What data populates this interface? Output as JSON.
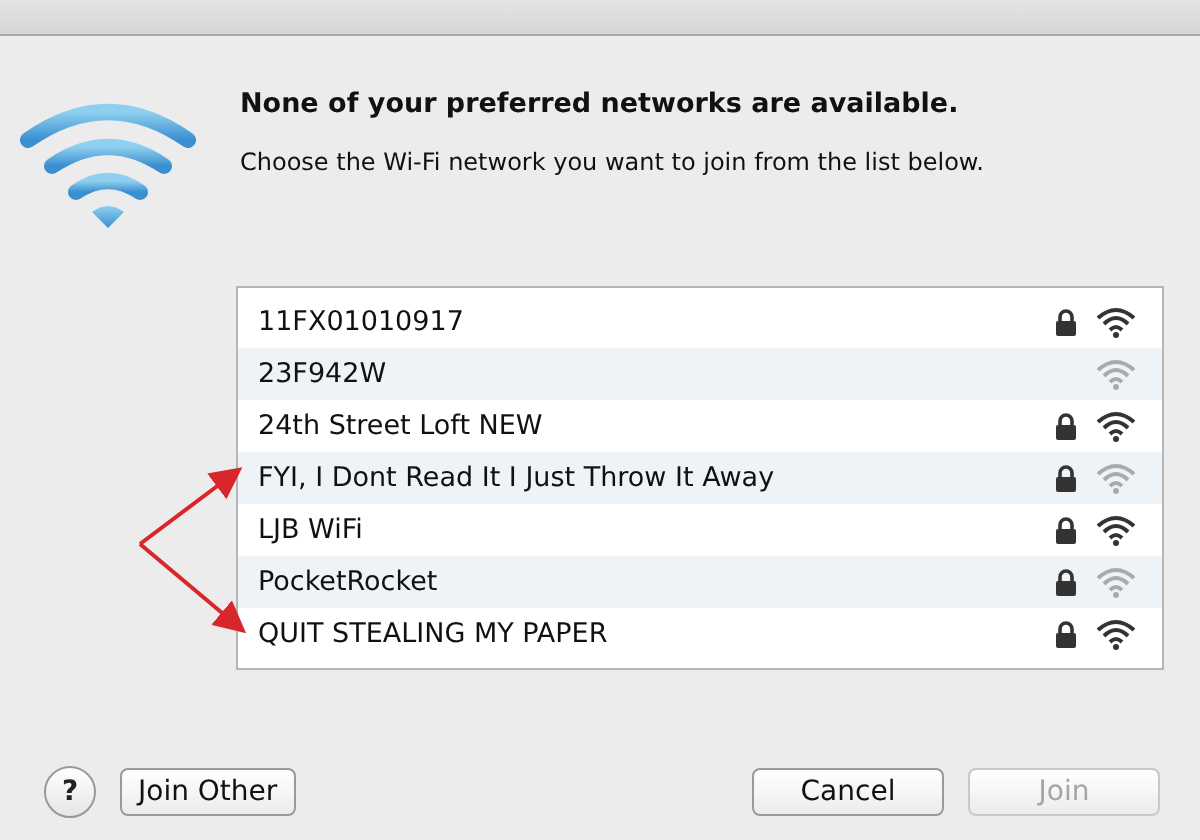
{
  "heading": "None of your preferred networks are available.",
  "message": "Choose the Wi-Fi network you want to join from the list below.",
  "networks": [
    {
      "name": "11FX01010917",
      "secured": true,
      "weak_signal": false
    },
    {
      "name": "23F942W",
      "secured": false,
      "weak_signal": true
    },
    {
      "name": "24th Street Loft NEW",
      "secured": true,
      "weak_signal": false
    },
    {
      "name": "FYI, I Dont Read It I Just Throw It Away",
      "secured": true,
      "weak_signal": true
    },
    {
      "name": "LJB WiFi",
      "secured": true,
      "weak_signal": false
    },
    {
      "name": "PocketRocket",
      "secured": true,
      "weak_signal": true
    },
    {
      "name": "QUIT STEALING MY PAPER",
      "secured": true,
      "weak_signal": false
    }
  ],
  "help_button": "?",
  "buttons": [
    {
      "label": "Join Other",
      "disabled": false
    },
    {
      "label": "Cancel",
      "disabled": false
    },
    {
      "label": "Join",
      "disabled": true
    }
  ]
}
